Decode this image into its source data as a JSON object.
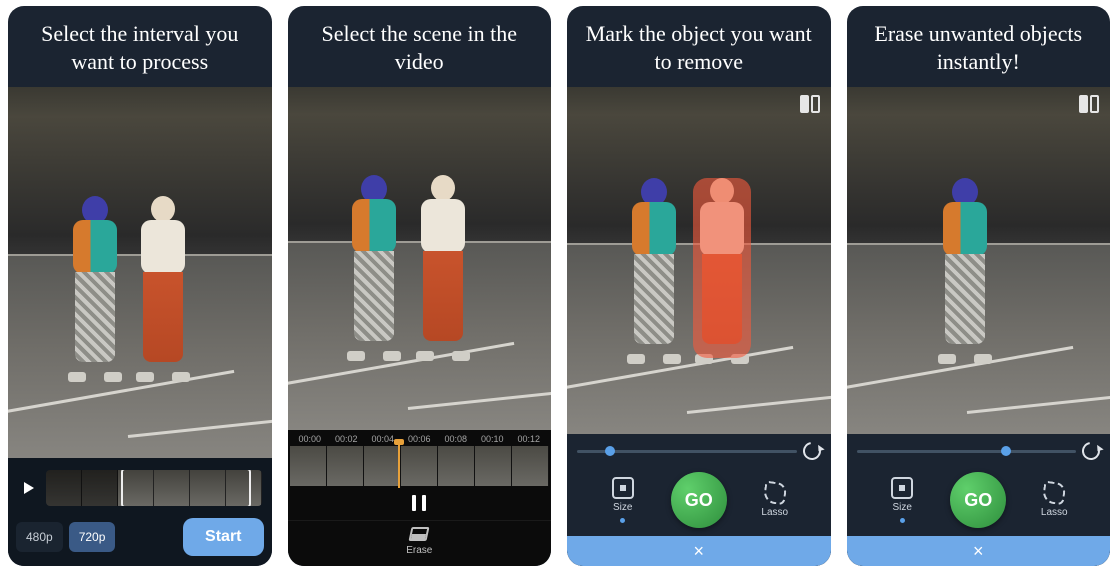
{
  "panels": [
    {
      "caption": "Select the interval you want to process"
    },
    {
      "caption": "Select the scene in the video"
    },
    {
      "caption": "Mark the object you want to remove"
    },
    {
      "caption": "Erase unwanted objects instantly!"
    }
  ],
  "p1": {
    "resolutions": {
      "r480": "480p",
      "r720": "720p",
      "active": "720p"
    },
    "start_label": "Start",
    "thumbs_total": 6,
    "selection_start_frac": 0.35,
    "selection_end_frac": 0.95
  },
  "p2": {
    "times": [
      "00:00",
      "00:02",
      "00:04",
      "00:06",
      "00:08",
      "00:10",
      "00:12"
    ],
    "playhead_frac": 0.42,
    "erase_label": "Erase"
  },
  "p3": {
    "brush_pos_frac": 0.15,
    "tools": {
      "size_label": "Size",
      "go_label": "GO",
      "lasso_label": "Lasso"
    },
    "close_label": "×"
  },
  "p4": {
    "brush_pos_frac": 0.68,
    "tools": {
      "size_label": "Size",
      "go_label": "GO",
      "lasso_label": "Lasso"
    },
    "close_label": "×"
  }
}
